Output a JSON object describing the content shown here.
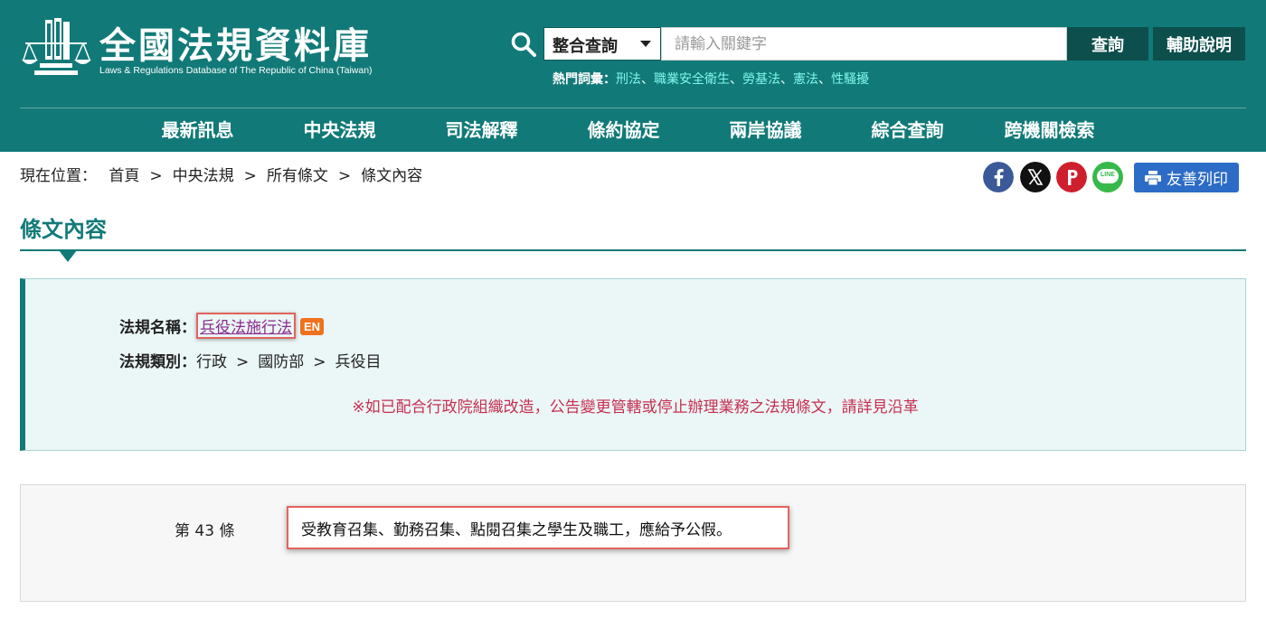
{
  "header": {
    "title": "全國法規資料庫",
    "subtitle": "Laws & Regulations Database of The Republic of China (Taiwan)",
    "search": {
      "type_label": "整合查詢",
      "placeholder": "請輸入關鍵字",
      "value": "",
      "search_label": "查詢",
      "help_label": "輔助說明"
    },
    "hot_terms": {
      "label": "熱門詞彙：",
      "terms": [
        "刑法",
        "職業安全衛生",
        "勞基法",
        "憲法",
        "性騷擾"
      ],
      "separator": "、"
    },
    "nav": [
      "最新訊息",
      "中央法規",
      "司法解釋",
      "條約協定",
      "兩岸協議",
      "綜合查詢",
      "跨機關檢索"
    ]
  },
  "breadcrumb": {
    "label": "現在位置：",
    "items": [
      "首頁",
      "中央法規",
      "所有條文",
      "條文內容"
    ],
    "separator": ">"
  },
  "share": {
    "icons": [
      "facebook-icon",
      "x-icon",
      "plurk-icon",
      "line-icon"
    ],
    "line_text": "LINE",
    "print_label": "友善列印"
  },
  "page": {
    "title": "條文內容"
  },
  "law_info": {
    "name_label": "法規名稱：",
    "name": "兵役法施行法",
    "en_badge": "EN",
    "category_label": "法規類別：",
    "category": [
      "行政",
      "國防部",
      "兵役目"
    ],
    "category_separator": ">",
    "notice": "※如已配合行政院組織改造，公告變更管轄或停止辦理業務之法規條文，請詳見沿革"
  },
  "article": {
    "number": "第 43 條",
    "text": "受教育召集、勤務召集、點閱召集之學生及職工，應給予公假。"
  },
  "colors": {
    "brand": "#117a78",
    "brand_dark": "#0c4f4d",
    "hot_term": "#7ff7ec",
    "notice": "#c62f51",
    "highlight": "#e3635d",
    "facebook": "#3b5998",
    "x": "#111111",
    "plurk": "#cf1f2c",
    "line": "#36b94a",
    "print": "#2c6cc6",
    "en_badge": "#f0721c"
  }
}
